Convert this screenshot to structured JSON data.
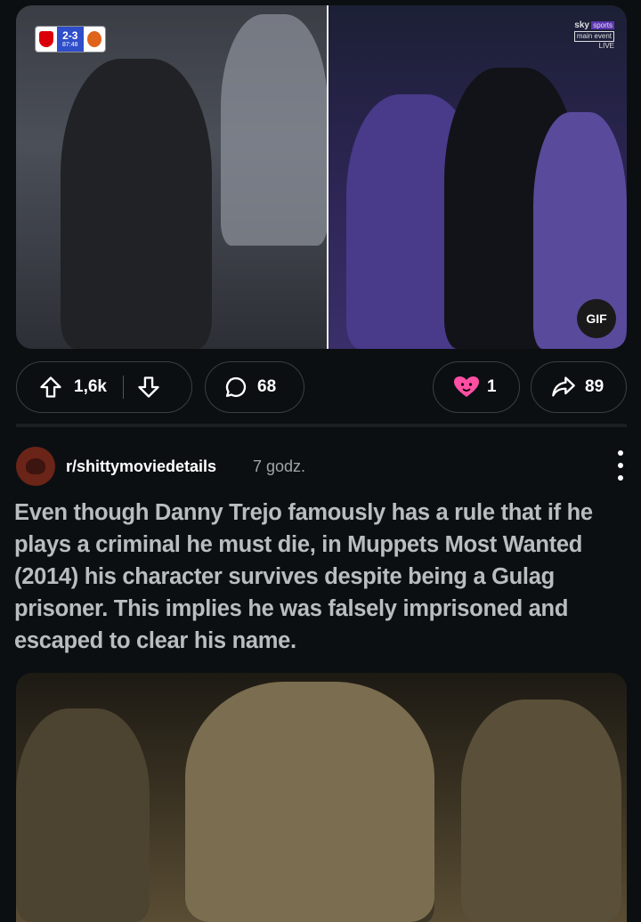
{
  "post1": {
    "media": {
      "scoreboard": {
        "score": "2-3",
        "clock": "87:48"
      },
      "broadcaster": {
        "brand": "sky",
        "channel": "sports",
        "event": "main event",
        "status": "LIVE"
      },
      "gif_label": "GIF"
    },
    "actions": {
      "upvotes": "1,6k",
      "comments": "68",
      "awards": "1",
      "shares": "89"
    }
  },
  "post2": {
    "subreddit": "r/shittymoviedetails",
    "time": "7 godz.",
    "title": "Even though Danny Trejo famously has a rule that if he plays a criminal he must die, in Muppets Most Wanted (2014) his character survives despite being a Gulag prisoner. This implies he was falsely imprisoned and escaped to clear his name."
  },
  "colors": {
    "background": "#0b0f12",
    "pill_border": "#3a3f44",
    "title_text": "#b9bdc0",
    "award_pink": "#ff4fa3"
  },
  "icons": {
    "upvote": "arrow-up-icon",
    "downvote": "arrow-down-icon",
    "comment": "speech-bubble-icon",
    "award": "heart-award-icon",
    "share": "share-arrow-icon",
    "more": "vertical-dots-icon"
  }
}
